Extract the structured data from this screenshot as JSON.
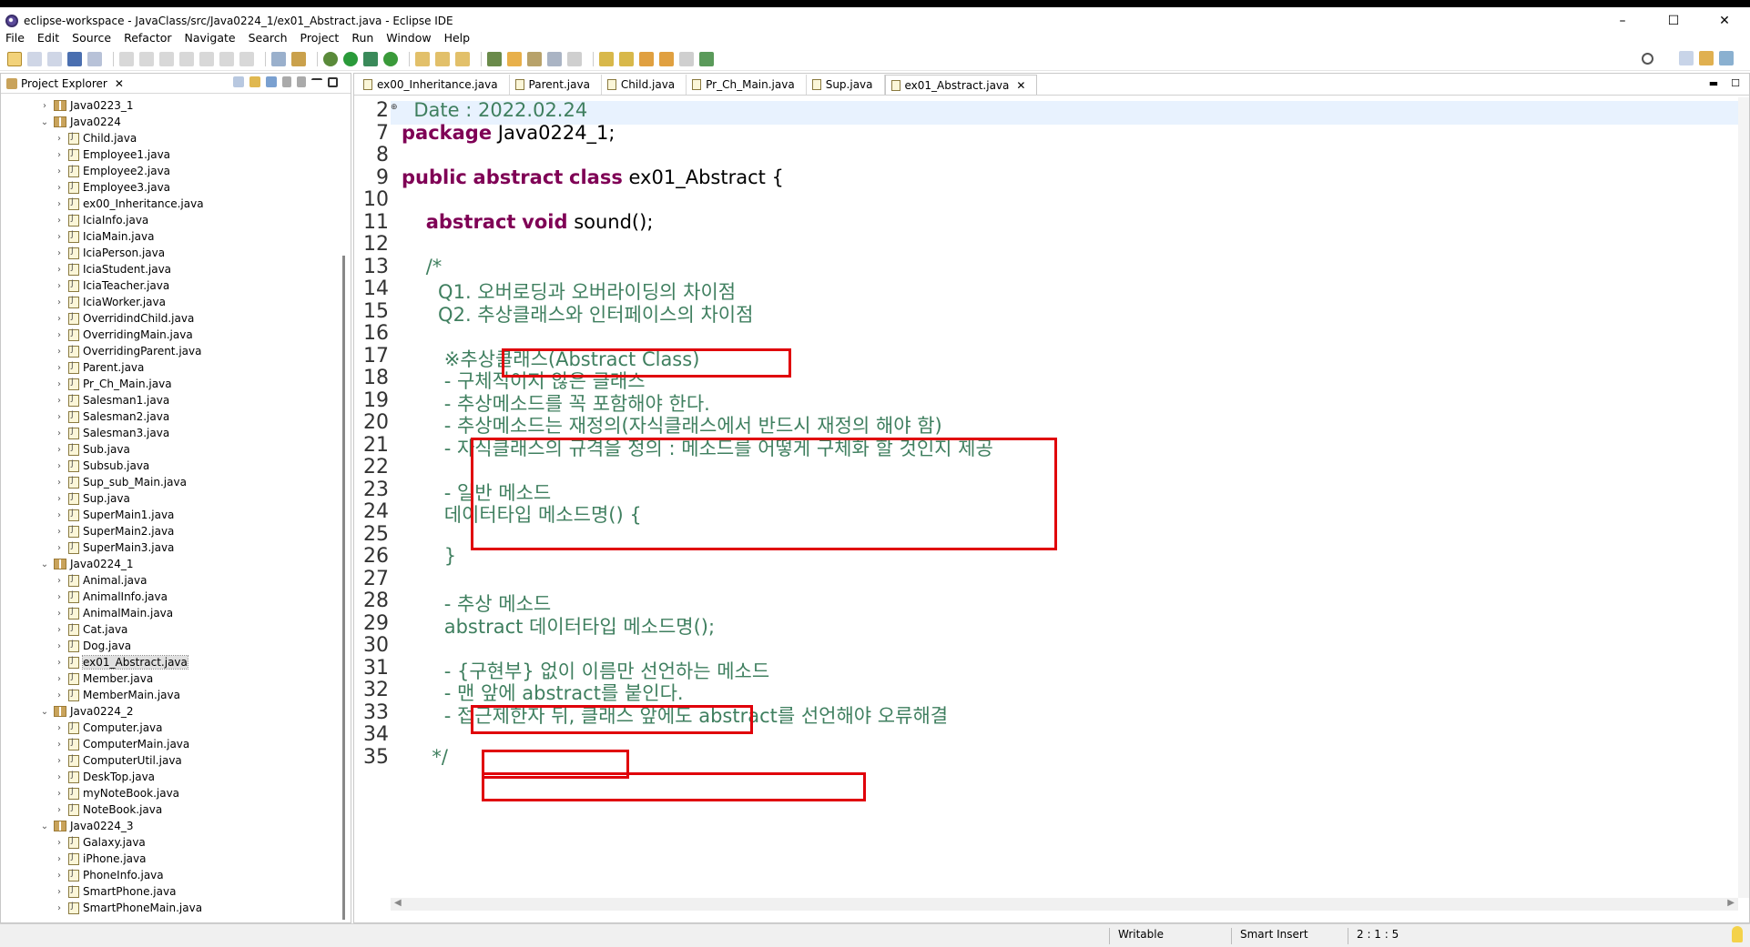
{
  "window": {
    "title": "eclipse-workspace - JavaClass/src/Java0224_1/ex01_Abstract.java - Eclipse IDE",
    "controls": [
      "–",
      "☐",
      "✕"
    ]
  },
  "menu": [
    "File",
    "Edit",
    "Source",
    "Refactor",
    "Navigate",
    "Search",
    "Project",
    "Run",
    "Window",
    "Help"
  ],
  "explorer": {
    "title": "Project Explorer",
    "tree": [
      {
        "label": "Java0223_1",
        "type": "package",
        "level": 0,
        "expanded": false
      },
      {
        "label": "Java0224",
        "type": "package",
        "level": 0,
        "expanded": true
      },
      {
        "label": "Child.java",
        "type": "java",
        "level": 1
      },
      {
        "label": "Employee1.java",
        "type": "java",
        "level": 1
      },
      {
        "label": "Employee2.java",
        "type": "java",
        "level": 1
      },
      {
        "label": "Employee3.java",
        "type": "java",
        "level": 1
      },
      {
        "label": "ex00_Inheritance.java",
        "type": "java",
        "level": 1
      },
      {
        "label": "IciaInfo.java",
        "type": "java",
        "level": 1
      },
      {
        "label": "IciaMain.java",
        "type": "java",
        "level": 1
      },
      {
        "label": "IciaPerson.java",
        "type": "java",
        "level": 1
      },
      {
        "label": "IciaStudent.java",
        "type": "java",
        "level": 1
      },
      {
        "label": "IciaTeacher.java",
        "type": "java",
        "level": 1
      },
      {
        "label": "IciaWorker.java",
        "type": "java",
        "level": 1
      },
      {
        "label": "OverridindChild.java",
        "type": "java",
        "level": 1
      },
      {
        "label": "OverridingMain.java",
        "type": "java",
        "level": 1
      },
      {
        "label": "OverridingParent.java",
        "type": "java",
        "level": 1
      },
      {
        "label": "Parent.java",
        "type": "java",
        "level": 1
      },
      {
        "label": "Pr_Ch_Main.java",
        "type": "java",
        "level": 1
      },
      {
        "label": "Salesman1.java",
        "type": "java",
        "level": 1
      },
      {
        "label": "Salesman2.java",
        "type": "java",
        "level": 1
      },
      {
        "label": "Salesman3.java",
        "type": "java",
        "level": 1
      },
      {
        "label": "Sub.java",
        "type": "java",
        "level": 1
      },
      {
        "label": "Subsub.java",
        "type": "java",
        "level": 1
      },
      {
        "label": "Sup_sub_Main.java",
        "type": "java",
        "level": 1
      },
      {
        "label": "Sup.java",
        "type": "java",
        "level": 1
      },
      {
        "label": "SuperMain1.java",
        "type": "java",
        "level": 1
      },
      {
        "label": "SuperMain2.java",
        "type": "java",
        "level": 1
      },
      {
        "label": "SuperMain3.java",
        "type": "java",
        "level": 1
      },
      {
        "label": "Java0224_1",
        "type": "package",
        "level": 0,
        "expanded": true
      },
      {
        "label": "Animal.java",
        "type": "java",
        "level": 1
      },
      {
        "label": "AnimalInfo.java",
        "type": "java",
        "level": 1
      },
      {
        "label": "AnimalMain.java",
        "type": "java",
        "level": 1
      },
      {
        "label": "Cat.java",
        "type": "java",
        "level": 1
      },
      {
        "label": "Dog.java",
        "type": "java",
        "level": 1
      },
      {
        "label": "ex01_Abstract.java",
        "type": "java",
        "level": 1,
        "selected": true
      },
      {
        "label": "Member.java",
        "type": "java",
        "level": 1
      },
      {
        "label": "MemberMain.java",
        "type": "java",
        "level": 1
      },
      {
        "label": "Java0224_2",
        "type": "package",
        "level": 0,
        "expanded": true
      },
      {
        "label": "Computer.java",
        "type": "java",
        "level": 1
      },
      {
        "label": "ComputerMain.java",
        "type": "java",
        "level": 1
      },
      {
        "label": "ComputerUtil.java",
        "type": "java",
        "level": 1
      },
      {
        "label": "DeskTop.java",
        "type": "java",
        "level": 1
      },
      {
        "label": "myNoteBook.java",
        "type": "java",
        "level": 1
      },
      {
        "label": "NoteBook.java",
        "type": "java",
        "level": 1
      },
      {
        "label": "Java0224_3",
        "type": "package",
        "level": 0,
        "expanded": true
      },
      {
        "label": "Galaxy.java",
        "type": "java",
        "level": 1
      },
      {
        "label": "iPhone.java",
        "type": "java",
        "level": 1
      },
      {
        "label": "PhoneInfo.java",
        "type": "java",
        "level": 1
      },
      {
        "label": "SmartPhone.java",
        "type": "java",
        "level": 1
      },
      {
        "label": "SmartPhoneMain.java",
        "type": "java",
        "level": 1
      }
    ]
  },
  "editor": {
    "tabs": [
      {
        "label": "ex00_Inheritance.java",
        "active": false
      },
      {
        "label": "Parent.java",
        "active": false
      },
      {
        "label": "Child.java",
        "active": false
      },
      {
        "label": "Pr_Ch_Main.java",
        "active": false
      },
      {
        "label": "Sup.java",
        "active": false
      },
      {
        "label": "ex01_Abstract.java",
        "active": true
      }
    ],
    "lines": [
      {
        "no": "2",
        "segments": [
          {
            "t": "  Date : 2022.02.24",
            "c": "cm"
          }
        ]
      },
      {
        "no": "7",
        "segments": [
          {
            "t": "package",
            "c": "kw"
          },
          {
            "t": " Java0224_1;",
            "c": ""
          }
        ]
      },
      {
        "no": "8",
        "segments": []
      },
      {
        "no": "9",
        "segments": [
          {
            "t": "public",
            "c": "kw"
          },
          {
            "t": " ",
            "c": ""
          },
          {
            "t": "abstract",
            "c": "kw"
          },
          {
            "t": " ",
            "c": ""
          },
          {
            "t": "class",
            "c": "kw"
          },
          {
            "t": " ex01_Abstract {",
            "c": ""
          }
        ]
      },
      {
        "no": "10",
        "segments": []
      },
      {
        "no": "11",
        "segments": [
          {
            "t": "    ",
            "c": ""
          },
          {
            "t": "abstract",
            "c": "kw"
          },
          {
            "t": " ",
            "c": ""
          },
          {
            "t": "void",
            "c": "kw"
          },
          {
            "t": " sound();",
            "c": ""
          }
        ]
      },
      {
        "no": "12",
        "segments": []
      },
      {
        "no": "13",
        "segments": [
          {
            "t": "    /*",
            "c": "cm"
          }
        ]
      },
      {
        "no": "14",
        "segments": [
          {
            "t": "      Q1. 오버로딩과 오버라이딩의 차이점",
            "c": "cm"
          }
        ]
      },
      {
        "no": "15",
        "segments": [
          {
            "t": "      Q2. 추상클래스와 인터페이스의 차이점",
            "c": "cm"
          }
        ]
      },
      {
        "no": "16",
        "segments": []
      },
      {
        "no": "17",
        "segments": [
          {
            "t": "       ※추상클래스(Abstract Class)",
            "c": "cm"
          }
        ]
      },
      {
        "no": "18",
        "segments": [
          {
            "t": "       - 구체적이지 않은 클래스",
            "c": "cm"
          }
        ]
      },
      {
        "no": "19",
        "segments": [
          {
            "t": "       - 추상메소드를 꼭 포함해야 한다.",
            "c": "cm"
          }
        ]
      },
      {
        "no": "20",
        "segments": [
          {
            "t": "       - 추상메소드는 재정의(자식클래스에서 반드시 재정의 해야 함)",
            "c": "cm"
          }
        ]
      },
      {
        "no": "21",
        "segments": [
          {
            "t": "       - 자식클래스의 규격을 정의 : 메소드를 어떻게 구체화 할 것인지 제공",
            "c": "cm"
          }
        ]
      },
      {
        "no": "22",
        "segments": []
      },
      {
        "no": "23",
        "segments": [
          {
            "t": "       - 일반 메소드",
            "c": "cm"
          }
        ]
      },
      {
        "no": "24",
        "segments": [
          {
            "t": "       데이터타입 메소드명() {",
            "c": "cm"
          }
        ]
      },
      {
        "no": "25",
        "segments": []
      },
      {
        "no": "26",
        "segments": [
          {
            "t": "       }",
            "c": "cm"
          }
        ]
      },
      {
        "no": "27",
        "segments": []
      },
      {
        "no": "28",
        "segments": [
          {
            "t": "       - 추상 메소드",
            "c": "cm"
          }
        ]
      },
      {
        "no": "29",
        "segments": [
          {
            "t": "       abstract 데이터타입 메소드명();",
            "c": "cm"
          }
        ]
      },
      {
        "no": "30",
        "segments": []
      },
      {
        "no": "31",
        "segments": [
          {
            "t": "       - {구현부} 없이 이름만 선언하는 메소드",
            "c": "cm"
          }
        ]
      },
      {
        "no": "32",
        "segments": [
          {
            "t": "       - 맨 앞에 abstract를 붙인다.",
            "c": "cm"
          }
        ]
      },
      {
        "no": "33",
        "segments": [
          {
            "t": "       - 접근제한자 뒤, 클래스 앞에도 abstract를 선언해야 오류해결",
            "c": "cm"
          }
        ]
      },
      {
        "no": "34",
        "segments": []
      },
      {
        "no": "35",
        "segments": [
          {
            "t": "     */",
            "c": "cm"
          }
        ]
      }
    ]
  },
  "status": {
    "writable": "Writable",
    "insert_mode": "Smart Insert",
    "position": "2 : 1 : 5"
  },
  "colors": {
    "keyword": "#7f0055",
    "comment": "#3f7f5f",
    "highlight_box": "#e0000a",
    "current_line": "#e8f2fe"
  }
}
